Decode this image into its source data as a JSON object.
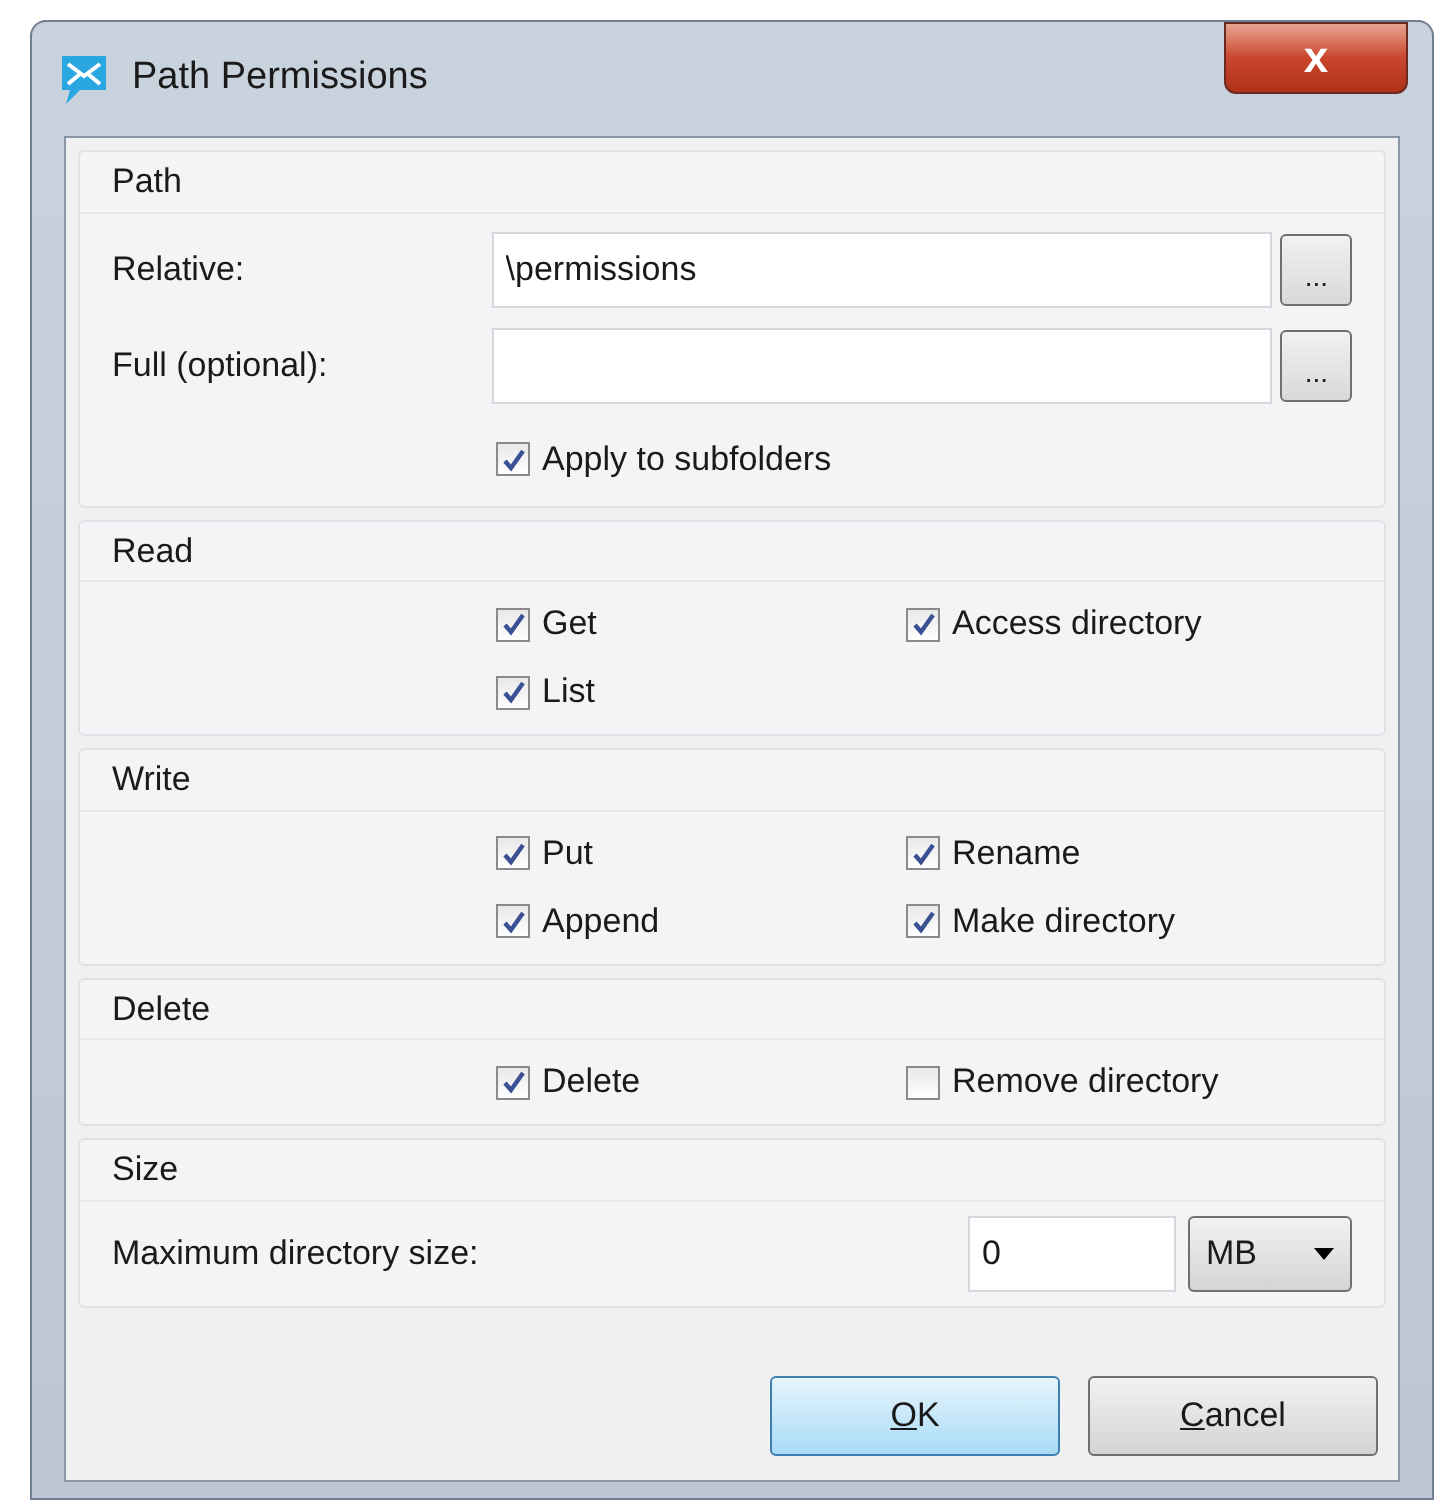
{
  "window": {
    "title": "Path Permissions",
    "close_label": "x"
  },
  "path": {
    "title": "Path",
    "fields": [
      {
        "label": "Relative:",
        "value": "\\permissions",
        "browse": "..."
      },
      {
        "label": "Full (optional):",
        "browse": "..."
      }
    ],
    "apply_subfolders": {
      "label": "Apply to subfolders",
      "checked": true
    }
  },
  "groups": [
    {
      "title": "Read",
      "options": [
        {
          "label": "Get",
          "checked": true
        },
        {
          "label": "Access directory",
          "checked": true
        },
        {
          "label": "List",
          "checked": true
        }
      ]
    },
    {
      "title": "Write",
      "options": [
        {
          "label": "Put",
          "checked": true
        },
        {
          "label": "Rename",
          "checked": true
        },
        {
          "label": "Append",
          "checked": true
        },
        {
          "label": "Make directory",
          "checked": true
        }
      ]
    },
    {
      "title": "Delete",
      "options": [
        {
          "label": "Delete",
          "checked": true
        },
        {
          "label": "Remove directory",
          "checked": false
        }
      ]
    }
  ],
  "size": {
    "title": "Size",
    "label": "Maximum directory size:",
    "value": "0",
    "unit": "MB"
  },
  "buttons": [
    {
      "label": "OK",
      "default": true,
      "mnemonic_underlined": true
    },
    {
      "label": "Cancel",
      "default": false,
      "mnemonic_underlined": true
    }
  ]
}
